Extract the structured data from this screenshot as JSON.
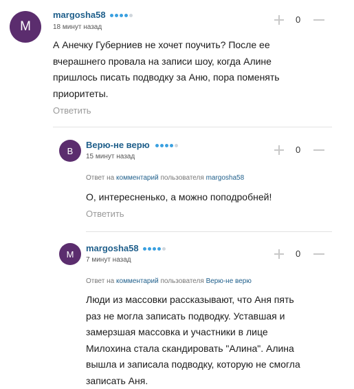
{
  "comments": [
    {
      "avatar_letter": "M",
      "author": "margosha58",
      "time": "18 минут назад",
      "score": "0",
      "text": "А Анечку Губерниев не хочет поучить? После ее вчерашнего провала на записи шоу, когда Алине пришлось писать подводку за Аню, пора поменять приоритеты.",
      "reply_label": "Ответить"
    },
    {
      "avatar_letter": "В",
      "author": "Верю-не верю",
      "time": "15 минут назад",
      "score": "0",
      "answer_prefix": "Ответ на",
      "answer_link": "комментарий",
      "answer_middle": "пользователя",
      "answer_user": "margosha58",
      "text": "О, интересненько, а можно поподробней!",
      "reply_label": "Ответить"
    },
    {
      "avatar_letter": "M",
      "author": "margosha58",
      "time": "7 минут назад",
      "score": "0",
      "answer_prefix": "Ответ на",
      "answer_link": "комментарий",
      "answer_middle": "пользователя",
      "answer_user": "Верю-не верю",
      "text": "Люди из массовки рассказывают, что Аня пять раз не могла записать подводку. Уставшая и замерзшая массовка и участники в лице Милохина стала скандировать \"Алина\". Алина вышла и записала подводку, которую не смогла записать Аня."
    }
  ],
  "colors": {
    "avatar": "#5b2d6e",
    "author": "#1f5f8b",
    "dot_active": "#3aa0e0",
    "dot_inactive": "#cfd6dc"
  },
  "icons": {
    "upvote": "plus-icon",
    "downvote": "minus-icon"
  }
}
